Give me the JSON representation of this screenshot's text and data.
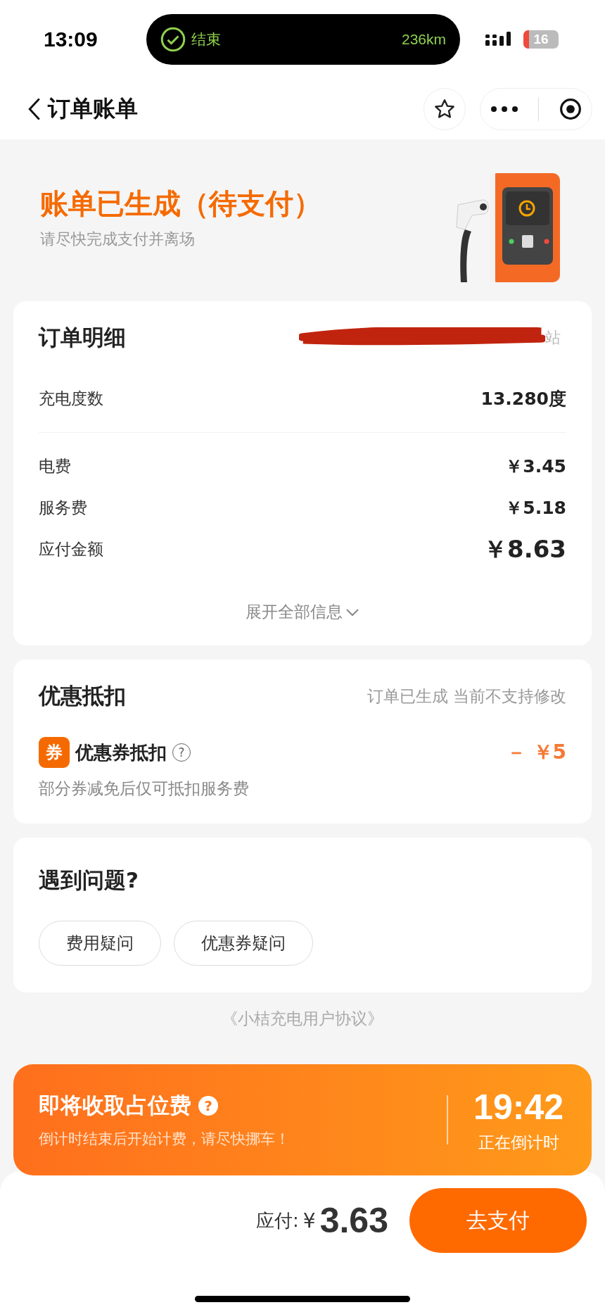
{
  "status_bar": {
    "time": "13:09",
    "activity": {
      "label": "结束",
      "distance": "236km"
    },
    "battery": "16"
  },
  "nav": {
    "title": "订单账单"
  },
  "header": {
    "title": "账单已生成（待支付）",
    "subtitle": "请尽快完成支付并离场"
  },
  "order_card": {
    "title": "订单明细",
    "station_tail": "站",
    "rows": [
      {
        "label": "充电度数",
        "value": "13.280度",
        "kind": "primary"
      },
      {
        "label": "电费",
        "value": "￥3.45",
        "kind": "normal"
      },
      {
        "label": "服务费",
        "value": "￥5.18",
        "kind": "normal"
      },
      {
        "label": "应付金额",
        "value": "￥8.63",
        "kind": "total"
      }
    ],
    "expand": "展开全部信息"
  },
  "discount_card": {
    "title": "优惠抵扣",
    "note": "订单已生成 当前不支持修改",
    "coupon": {
      "badge": "券",
      "label": "优惠券抵扣",
      "help": "?",
      "amount": "－ ￥5",
      "hint": "部分券减免后仅可抵扣服务费"
    }
  },
  "help_card": {
    "title": "遇到问题?",
    "buttons": [
      "费用疑问",
      "优惠券疑问"
    ]
  },
  "agreement": "《小桔充电用户协议》",
  "occupancy_banner": {
    "title": "即将收取占位费",
    "help": "?",
    "subtitle": "倒计时结束后开始计费，请尽快挪车！",
    "countdown": "19:42",
    "countdown_label": "正在倒计时"
  },
  "pay_bar": {
    "label": "应付:",
    "currency": "¥",
    "amount": "3.63",
    "button": "去支付"
  }
}
